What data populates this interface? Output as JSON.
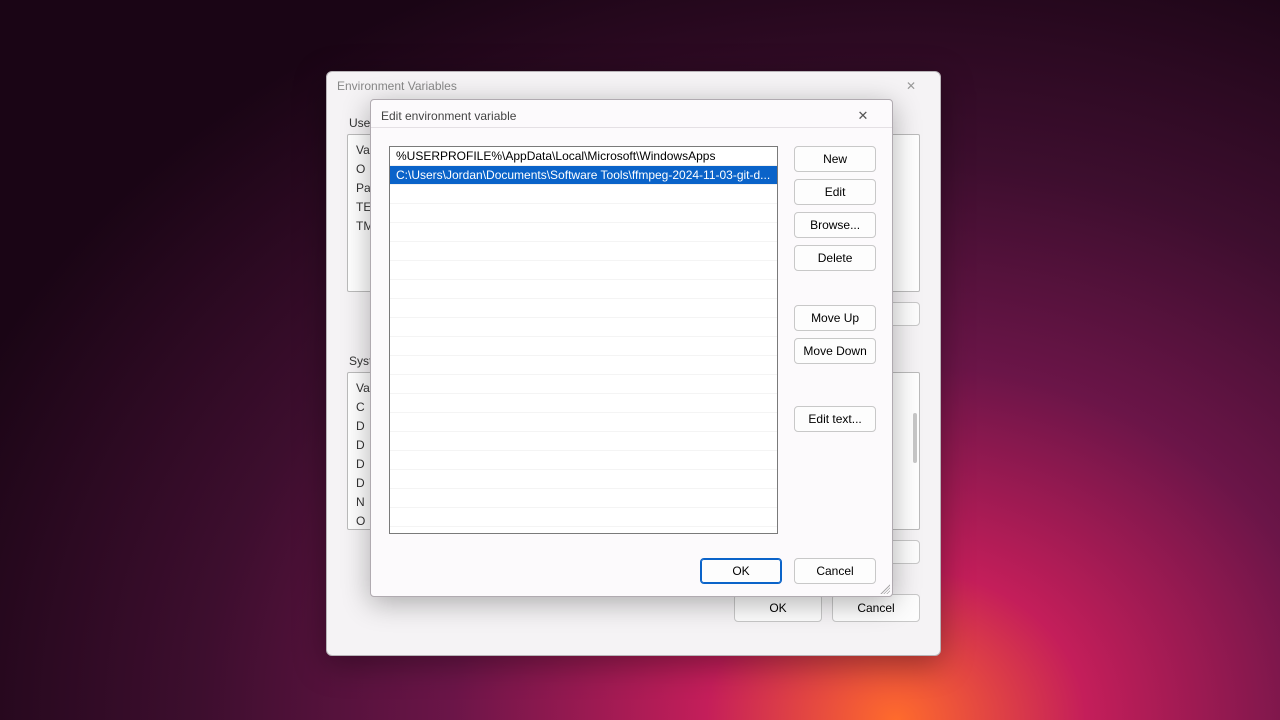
{
  "parent": {
    "title": "Environment Variables",
    "userLabel": "User",
    "userVars": [
      "Va",
      "O",
      "Pa",
      "TE",
      "TM"
    ],
    "sysLabel": "Syst",
    "sysVars": [
      "Va",
      "C",
      "D",
      "D",
      "D",
      "D",
      "N",
      "O"
    ],
    "ok": "OK",
    "cancel": "Cancel"
  },
  "child": {
    "title": "Edit environment variable",
    "paths": [
      "%USERPROFILE%\\AppData\\Local\\Microsoft\\WindowsApps",
      "C:\\Users\\Jordan\\Documents\\Software Tools\\ffmpeg-2024-11-03-git-d..."
    ],
    "selectedIndex": 1,
    "buttons": {
      "new": "New",
      "edit": "Edit",
      "browse": "Browse...",
      "delete": "Delete",
      "moveUp": "Move Up",
      "moveDown": "Move Down",
      "editText": "Edit text..."
    },
    "ok": "OK",
    "cancel": "Cancel"
  }
}
